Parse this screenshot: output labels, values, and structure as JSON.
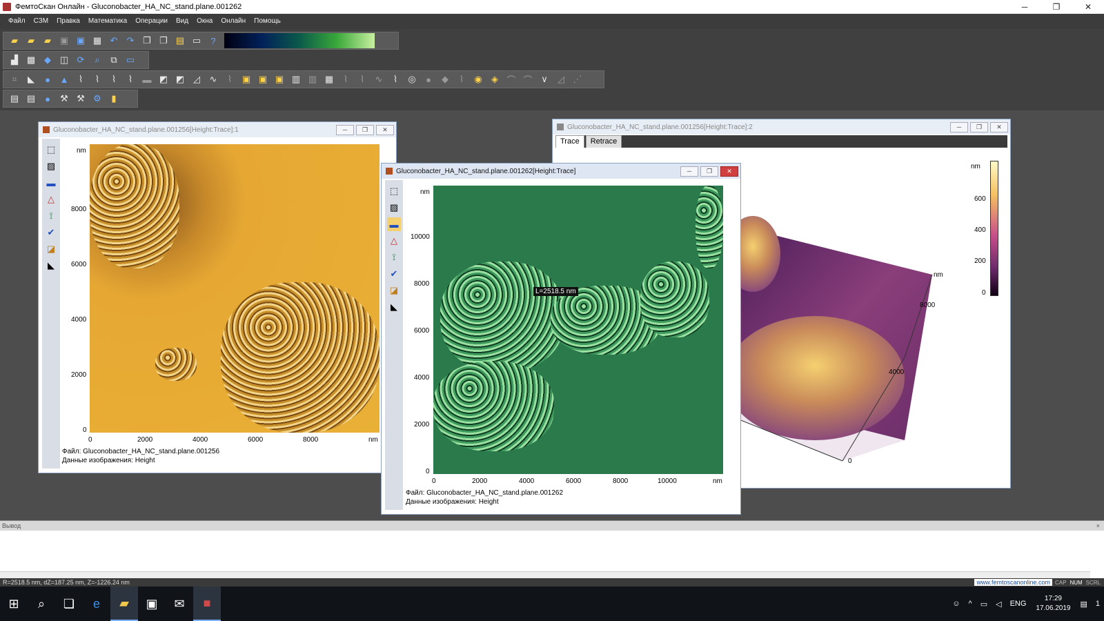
{
  "window": {
    "title": "ФемтоСкан Онлайн - Gluconobacter_HA_NC_stand.plane.001262",
    "minimize": "─",
    "maximize": "❐",
    "close": "✕"
  },
  "menu": [
    "Файл",
    "СЗМ",
    "Правка",
    "Математика",
    "Операции",
    "Вид",
    "Окна",
    "Онлайн",
    "Помощь"
  ],
  "doc1": {
    "title": "Gluconobacter_HA_NC_stand.plane.001256[Height:Trace]:1",
    "axis_unit": "nm",
    "y_ticks": [
      "8000",
      "6000",
      "4000",
      "2000",
      "0"
    ],
    "x_ticks": [
      "0",
      "2000",
      "4000",
      "6000",
      "8000"
    ],
    "file_line": "Файл: Gluconobacter_HA_NC_stand.plane.001256",
    "data_line": "Данные изображения: Height"
  },
  "doc2": {
    "title": "Gluconobacter_HA_NC_stand.plane.001262[Height:Trace]",
    "axis_unit": "nm",
    "y_ticks": [
      "10000",
      "8000",
      "6000",
      "4000",
      "2000",
      "0"
    ],
    "x_ticks": [
      "0",
      "2000",
      "4000",
      "6000",
      "8000",
      "10000"
    ],
    "measure_label": "L=2518.5 nm",
    "file_line": "Файл: Gluconobacter_HA_NC_stand.plane.001262",
    "data_line": "Данные изображения: Height"
  },
  "doc3": {
    "title": "Gluconobacter_HA_NC_stand.plane.001256[Height:Trace]:2",
    "tabs": [
      "Trace",
      "Retrace"
    ],
    "colorbar_unit": "nm",
    "colorbar_ticks": [
      "600",
      "400",
      "200",
      "0"
    ],
    "axis_unit": "nm",
    "axis_ticks": [
      "8000",
      "4000",
      "0"
    ]
  },
  "output": {
    "title": "Вывод",
    "close": "×"
  },
  "status": {
    "coords": "R=2518.5 nm, dZ=187.25 nm, Z=-1226.24 nm",
    "site": "www.femtoscanonline.com",
    "indicators": [
      "CAP",
      "NUM",
      "SCRL"
    ]
  },
  "taskbar": {
    "lang": "ENG",
    "time": "17:29",
    "date": "17.06.2019",
    "notifications": "1"
  },
  "colors": {
    "accent": "#7ab0ff",
    "mdi_bg": "#4d4d4d",
    "image1": "#e9b036",
    "image2": "#2b7a4c"
  }
}
